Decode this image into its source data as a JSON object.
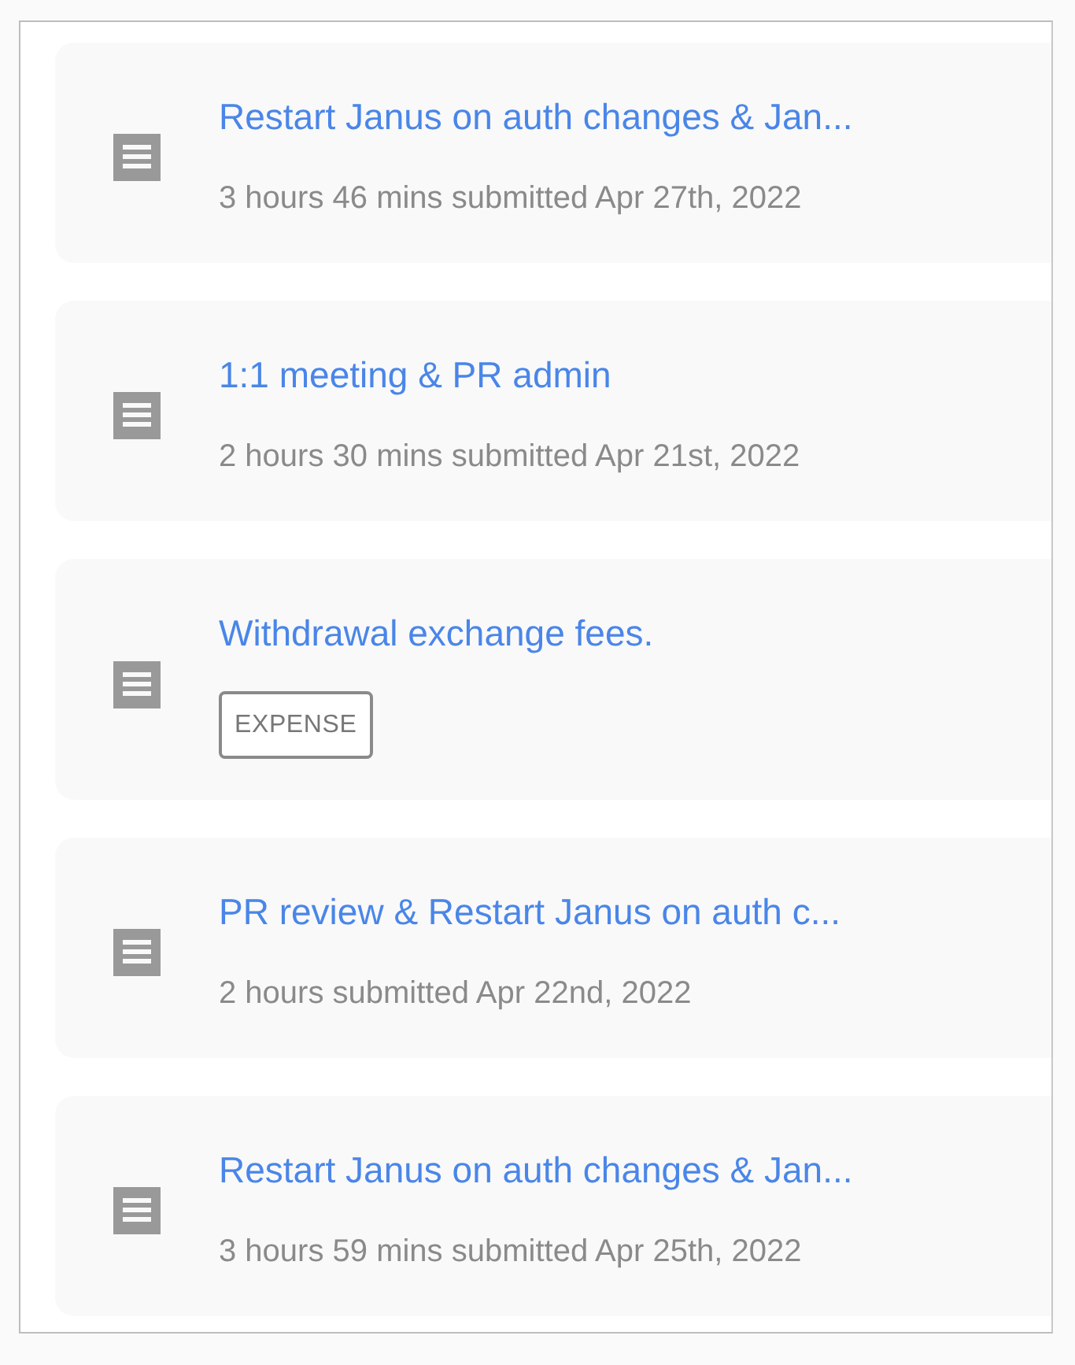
{
  "entries": [
    {
      "kind": "summary",
      "title": "Restart Janus on auth changes & Jan...",
      "detail": "3 hours 46 mins submitted Apr 27th, 2022"
    },
    {
      "kind": "summary",
      "title": "1:1 meeting & PR admin",
      "detail": "2 hours 30 mins submitted Apr 21st, 2022"
    },
    {
      "kind": "tag",
      "title": "Withdrawal exchange fees.",
      "detail": "EXPENSE"
    },
    {
      "kind": "summary",
      "title": "PR review & Restart Janus on auth c...",
      "detail": "2 hours submitted Apr 22nd, 2022"
    },
    {
      "kind": "summary",
      "title": "Restart Janus on auth changes & Jan...",
      "detail": "3 hours 59 mins submitted Apr 25th, 2022"
    }
  ]
}
